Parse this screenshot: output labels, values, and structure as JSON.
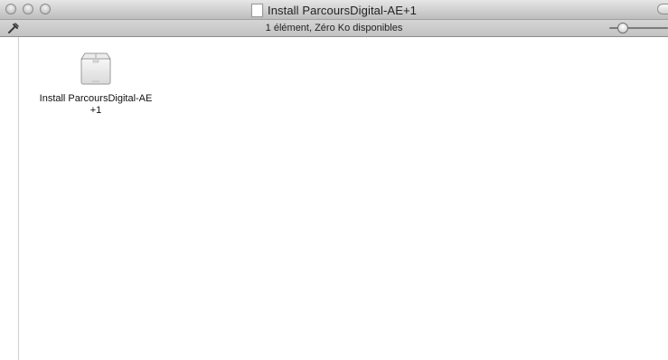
{
  "window": {
    "title": "Install ParcoursDigital-AE+1"
  },
  "statusbar": {
    "status_text": "1 élément, Zéro Ko disponibles",
    "icon_size_slider_level": 0.15
  },
  "files": [
    {
      "name_line1": "Install ParcoursDigital-AE",
      "name_line2": "+1",
      "icon": "package-box-icon"
    }
  ],
  "colors": {
    "titlebar_top": "#e6e6e6",
    "titlebar_bottom": "#bdbdbd",
    "statusbar": "#c8c8c8",
    "content_bg": "#ffffff"
  }
}
